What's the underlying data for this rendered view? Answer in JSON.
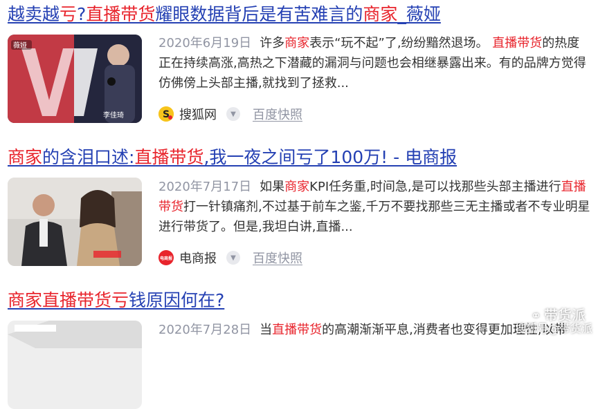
{
  "results": [
    {
      "title": [
        {
          "t": "越卖越",
          "hl": false
        },
        {
          "t": "亏",
          "hl": true
        },
        {
          "t": "?",
          "hl": false
        },
        {
          "t": "直播带货",
          "hl": true
        },
        {
          "t": "耀眼数据背后是有苦难言的",
          "hl": false
        },
        {
          "t": "商家",
          "hl": true
        },
        {
          "t": "_薇娅",
          "hl": false
        }
      ],
      "date": "2020年6月19日",
      "abstract": [
        {
          "t": "许多",
          "hl": false
        },
        {
          "t": "商家",
          "hl": true
        },
        {
          "t": "表示“玩不起”了,纷纷黯然退场。 ",
          "hl": false
        },
        {
          "t": "直播带货",
          "hl": true
        },
        {
          "t": "的热度正在持续高涨,高热之下潜藏的漏洞与问题也会相继暴露出来。有的品牌方觉得仿佛傍上头部主播,就找到了拯救...",
          "hl": false
        }
      ],
      "source": "搜狐网",
      "source_icon": "sohu-logo-icon",
      "snapshot": "百度快照",
      "thumb_texts": [
        "薇娅",
        "李佳琦"
      ]
    },
    {
      "title": [
        {
          "t": "商家",
          "hl": true
        },
        {
          "t": "的含泪口述:",
          "hl": false
        },
        {
          "t": "直播带货",
          "hl": true
        },
        {
          "t": ",我一夜之间亏了100万! - 电商报",
          "hl": false
        }
      ],
      "date": "2020年7月17日",
      "abstract": [
        {
          "t": "如果",
          "hl": false
        },
        {
          "t": "商家",
          "hl": true
        },
        {
          "t": "KPI任务重,时间急,是可以找那些头部主播进行",
          "hl": false
        },
        {
          "t": "直播带货",
          "hl": true
        },
        {
          "t": "打一针镇痛剂,不过基于前车之鉴,千万不要找那些三无主播或者不专业明星进行带货了。但是,我坦白讲,直播...",
          "hl": false
        }
      ],
      "source": "电商报",
      "source_icon": "dsb-logo-icon",
      "source_icon_text": "电商报",
      "snapshot": "百度快照"
    },
    {
      "title": [
        {
          "t": "商家直播带货亏",
          "hl": true
        },
        {
          "t": "钱原因何在?",
          "hl": false
        }
      ],
      "date": "2020年7月28日",
      "abstract": [
        {
          "t": "当",
          "hl": false
        },
        {
          "t": "直播带货",
          "hl": true
        },
        {
          "t": "的高潮渐渐平息,消费者也变得更加理性,以带",
          "hl": false
        }
      ]
    }
  ],
  "watermark": {
    "brand": "带货派",
    "account": "搜狐号@带货派"
  },
  "colors": {
    "title_link": "#2440b3",
    "highlight": "#e8242c",
    "date": "#9195a3"
  }
}
